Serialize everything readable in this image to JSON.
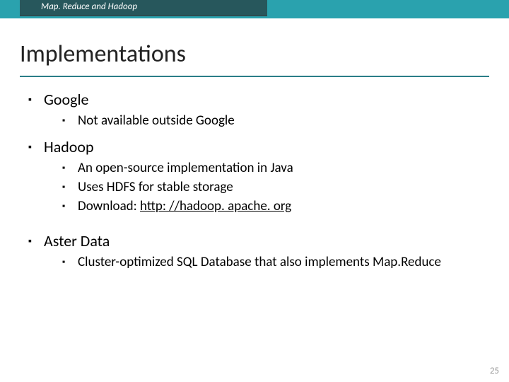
{
  "header": {
    "breadcrumb": "Map. Reduce and Hadoop"
  },
  "title": "Implementations",
  "bullets": [
    {
      "label": "Google",
      "children": [
        {
          "label": "Not available outside Google"
        }
      ]
    },
    {
      "label": "Hadoop",
      "children": [
        {
          "label": "An open-source implementation in Java"
        },
        {
          "label": "Uses HDFS for stable storage"
        },
        {
          "label_prefix": "Download: ",
          "link_text": "http: //hadoop. apache. org"
        }
      ]
    },
    {
      "label": "Aster Data",
      "spaced": true,
      "children": [
        {
          "label": "Cluster-optimized SQL Database that also implements Map.Reduce"
        }
      ]
    }
  ],
  "page_number": "25"
}
